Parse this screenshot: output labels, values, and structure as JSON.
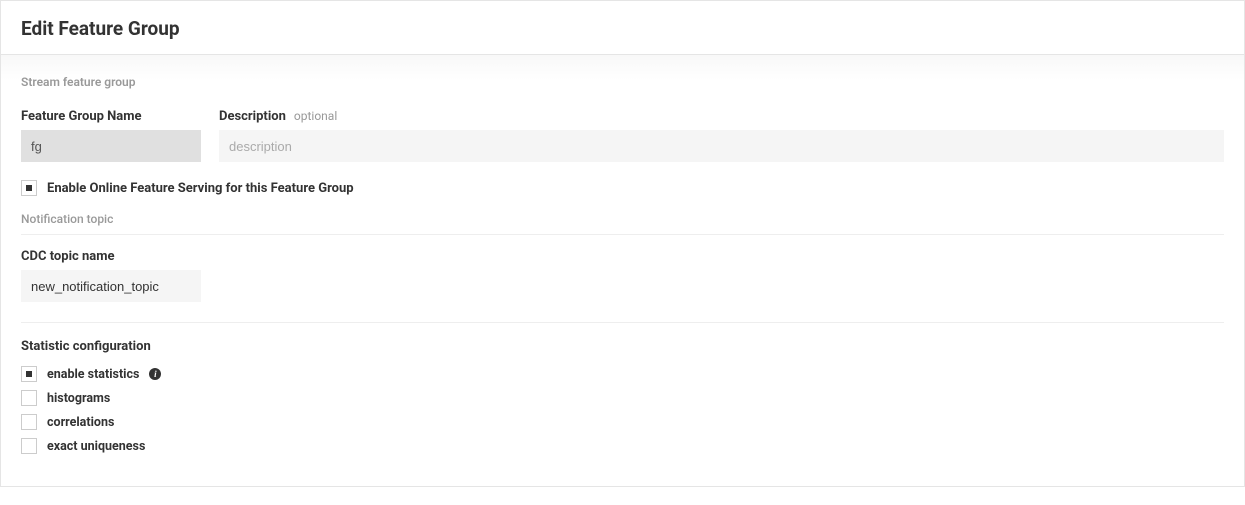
{
  "header": {
    "title": "Edit Feature Group"
  },
  "stream": {
    "subtitle": "Stream feature group",
    "name_label": "Feature Group Name",
    "name_value": "fg",
    "desc_label": "Description",
    "desc_optional": "optional",
    "desc_placeholder": "description",
    "desc_value": ""
  },
  "online": {
    "label": "Enable Online Feature Serving for this Feature Group",
    "checked": true
  },
  "notification": {
    "section_label": "Notification topic",
    "cdc_label": "CDC topic name",
    "cdc_value": "new_notification_topic"
  },
  "stats": {
    "heading": "Statistic configuration",
    "items": [
      {
        "label": "enable statistics",
        "checked": true,
        "info": true
      },
      {
        "label": "histograms",
        "checked": false,
        "info": false
      },
      {
        "label": "correlations",
        "checked": false,
        "info": false
      },
      {
        "label": "exact uniqueness",
        "checked": false,
        "info": false
      }
    ]
  }
}
